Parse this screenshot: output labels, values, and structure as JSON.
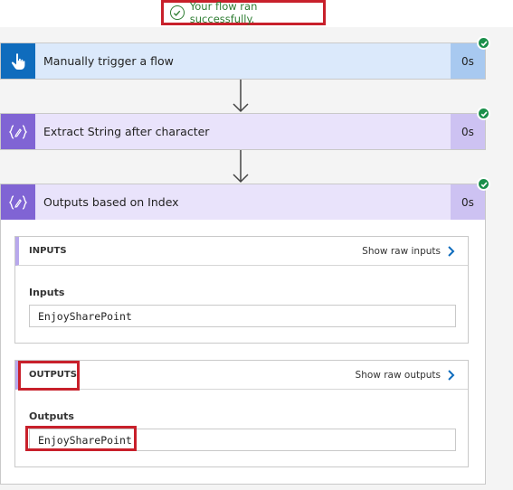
{
  "banner": {
    "message": "Your flow ran successfully."
  },
  "steps": [
    {
      "title": "Manually trigger a flow",
      "duration": "0s"
    },
    {
      "title": "Extract String after character",
      "duration": "0s"
    },
    {
      "title": "Outputs based on Index",
      "duration": "0s"
    }
  ],
  "inputs_panel": {
    "header": "INPUTS",
    "show_raw": "Show raw inputs",
    "field_label": "Inputs",
    "field_value": "EnjoySharePoint"
  },
  "outputs_panel": {
    "header": "OUTPUTS",
    "show_raw": "Show raw outputs",
    "field_label": "Outputs",
    "field_value": "EnjoySharePoint"
  },
  "icons": {
    "trigger": "hand-pointer-icon",
    "expression": "expression-icon",
    "success": "check-circle-icon",
    "status": "success-check-icon",
    "chevron": "chevron-right-icon",
    "arrow": "arrow-down-icon"
  },
  "colors": {
    "highlight": "#c8202b",
    "success": "#1a8f4a",
    "trigger_accent": "#0f6cbd",
    "action_accent": "#8064d4",
    "link": "#0f6cbd"
  }
}
